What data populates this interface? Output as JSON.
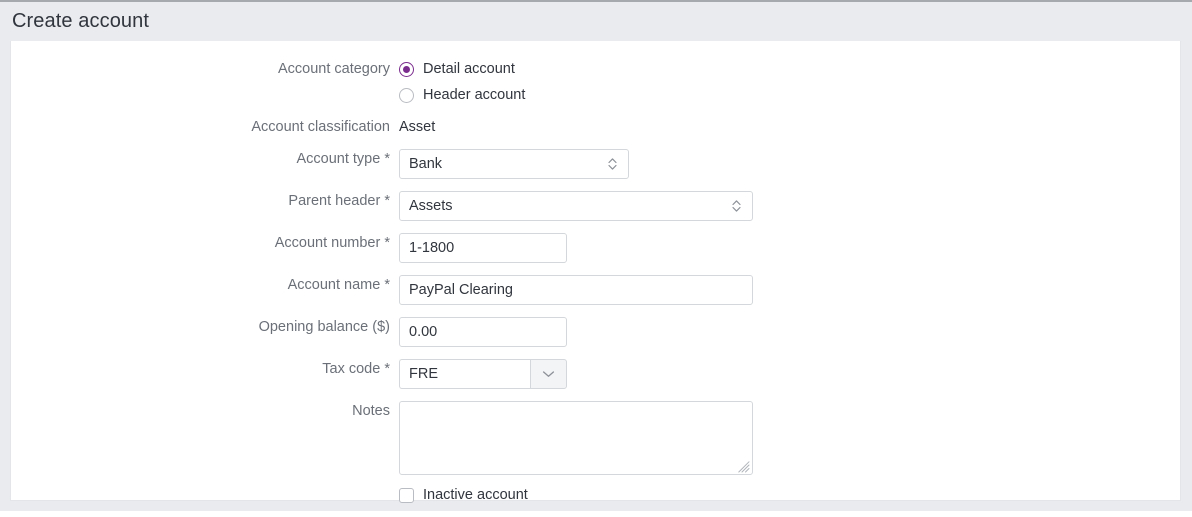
{
  "header": {
    "title": "Create account"
  },
  "form": {
    "account_category": {
      "label": "Account category",
      "options": [
        {
          "label": "Detail account",
          "selected": true
        },
        {
          "label": "Header account",
          "selected": false
        }
      ]
    },
    "account_classification": {
      "label": "Account classification",
      "value": "Asset"
    },
    "account_type": {
      "label": "Account type",
      "required_mark": "*",
      "value": "Bank",
      "control": "select"
    },
    "parent_header": {
      "label": "Parent header",
      "required_mark": "*",
      "value": "Assets",
      "control": "select"
    },
    "account_number": {
      "label": "Account number",
      "required_mark": "*",
      "value": "1-1800",
      "control": "text"
    },
    "account_name": {
      "label": "Account name",
      "required_mark": "*",
      "value": "PayPal Clearing",
      "control": "text"
    },
    "opening_balance": {
      "label": "Opening balance ($)",
      "value": "0.00",
      "control": "text"
    },
    "tax_code": {
      "label": "Tax code",
      "required_mark": "*",
      "value": "FRE",
      "control": "combobox"
    },
    "notes": {
      "label": "Notes",
      "value": "",
      "placeholder": "",
      "control": "textarea"
    },
    "inactive_account": {
      "label": "Inactive account",
      "checked": false
    }
  },
  "icons": {
    "stepper": "select-stepper-icon",
    "chevron_down": "chevron-down-icon",
    "resize": "resize-grip-icon"
  },
  "colors": {
    "accent": "#7b2d8e",
    "header_bg": "#e9ebee",
    "border": "#d4d7db",
    "label_text": "#6b7078",
    "value_text": "#31353d"
  }
}
